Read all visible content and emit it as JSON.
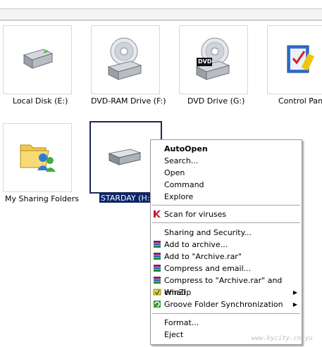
{
  "drives": [
    {
      "label": "Local Disk (E:)",
      "icon": "hard-disk-icon"
    },
    {
      "label": "DVD-RAM Drive (F:)",
      "icon": "dvd-ram-drive-icon"
    },
    {
      "label": "DVD Drive (G:)",
      "icon": "dvd-drive-icon",
      "badge": "DVD"
    },
    {
      "label": "Control Panel",
      "icon": "control-panel-icon"
    },
    {
      "label": "My Sharing Folders",
      "icon": "sharing-folder-icon"
    },
    {
      "label": "STARDAY (H:)",
      "icon": "removable-disk-icon",
      "selected": true
    }
  ],
  "context_menu": {
    "items": [
      {
        "label": "AutoOpen",
        "bold": true
      },
      {
        "label": "Search..."
      },
      {
        "label": "Open"
      },
      {
        "label": "Command"
      },
      {
        "label": "Explore"
      },
      {
        "label": "Scan for viruses",
        "icon": "kaspersky-icon"
      },
      {
        "label": "Sharing and Security..."
      },
      {
        "label": "Add to archive...",
        "icon": "winrar-icon"
      },
      {
        "label": "Add to \"Archive.rar\"",
        "icon": "winrar-icon"
      },
      {
        "label": "Compress and email...",
        "icon": "winrar-icon"
      },
      {
        "label": "Compress to \"Archive.rar\" and email",
        "icon": "winrar-icon"
      },
      {
        "label": "WinZip",
        "icon": "winzip-icon",
        "submenu": true
      },
      {
        "label": "Groove Folder Synchronization",
        "icon": "groove-icon",
        "submenu": true
      },
      {
        "label": "Format..."
      },
      {
        "label": "Eject"
      }
    ],
    "submenu_arrow": "▶"
  },
  "watermark": "www.kycity.cn.yu"
}
